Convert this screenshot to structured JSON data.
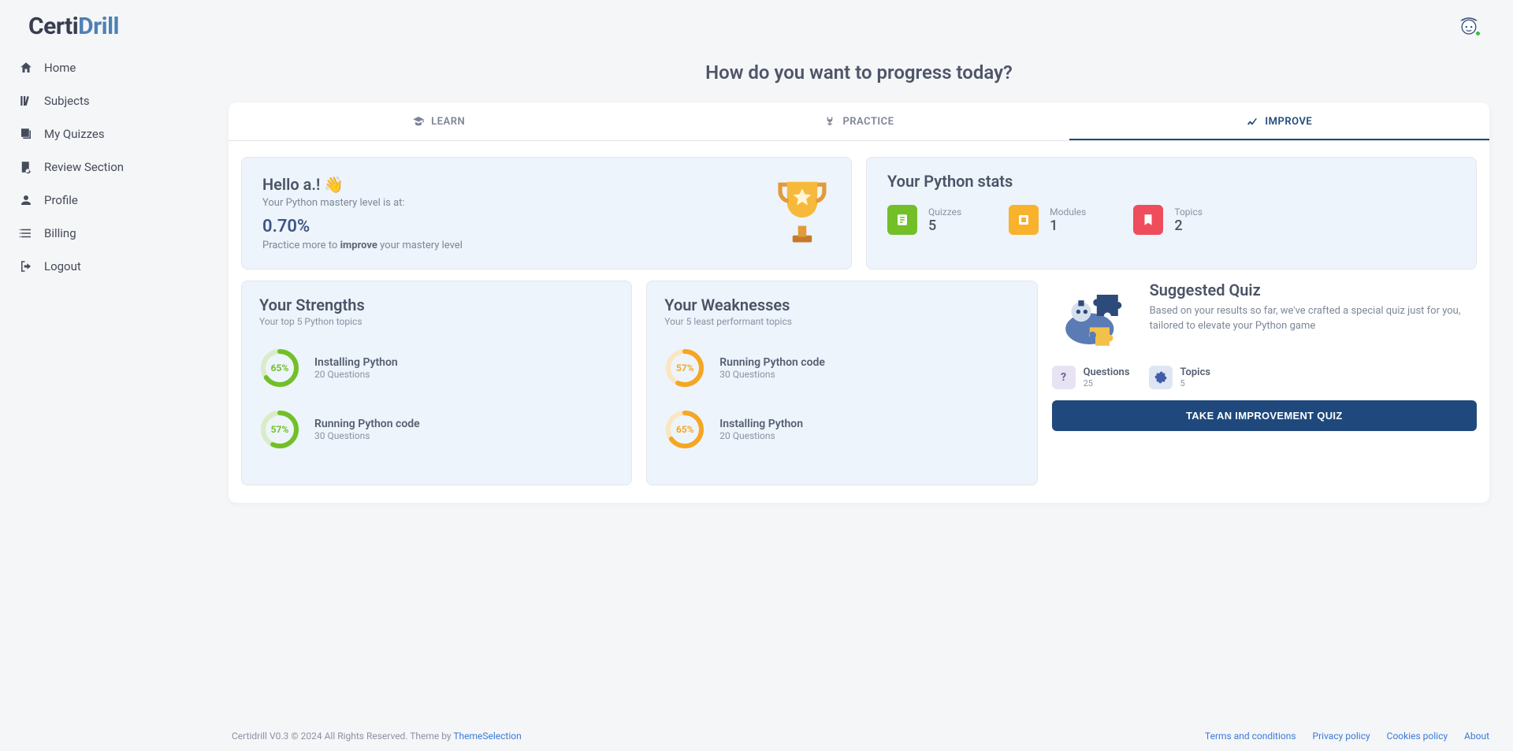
{
  "brand": {
    "part1": "Certi",
    "part2": "Drill"
  },
  "nav": [
    {
      "label": "Home"
    },
    {
      "label": "Subjects"
    },
    {
      "label": "My Quizzes"
    },
    {
      "label": "Review Section"
    },
    {
      "label": "Profile"
    },
    {
      "label": "Billing"
    },
    {
      "label": "Logout"
    }
  ],
  "headline": "How do you want to progress today?",
  "tabs": {
    "learn": "LEARN",
    "practice": "PRACTICE",
    "improve": "IMPROVE"
  },
  "subject": "Python",
  "hello": {
    "greeting": "Hello a.! 👋",
    "sub": "Your Python mastery level is at:",
    "percent": "0.70%",
    "tip_pre": "Practice more to ",
    "tip_bold": "improve",
    "tip_post": " your mastery level"
  },
  "stats_title": "Your Python stats",
  "stats": [
    {
      "label": "Quizzes",
      "value": "5"
    },
    {
      "label": "Modules",
      "value": "1"
    },
    {
      "label": "Topics",
      "value": "2"
    }
  ],
  "strengths": {
    "title": "Your Strengths",
    "desc": "Your top 5 Python topics",
    "items": [
      {
        "pct": 65,
        "pct_label": "65%",
        "name": "Installing Python",
        "q": "20 Questions"
      },
      {
        "pct": 57,
        "pct_label": "57%",
        "name": "Running Python code",
        "q": "30 Questions"
      }
    ]
  },
  "weaknesses": {
    "title": "Your Weaknesses",
    "desc": "Your 5 least performant topics",
    "items": [
      {
        "pct": 57,
        "pct_label": "57%",
        "name": "Running Python code",
        "q": "30 Questions"
      },
      {
        "pct": 65,
        "pct_label": "65%",
        "name": "Installing Python",
        "q": "20 Questions"
      }
    ]
  },
  "suggested": {
    "title": "Suggested Quiz",
    "desc": "Based on your results so far, we've crafted a special quiz just for you, tailored to elevate your Python game",
    "questions_label": "Questions",
    "questions_value": "25",
    "topics_label": "Topics",
    "topics_value": "5",
    "button": "TAKE AN IMPROVEMENT QUIZ"
  },
  "footer": {
    "copyright": "Certidrill V0.3 © 2024 All Rights Reserved. Theme by ",
    "theme_by": "ThemeSelection",
    "links": [
      "Terms and conditions",
      "Privacy policy",
      "Cookies policy",
      "About"
    ]
  }
}
